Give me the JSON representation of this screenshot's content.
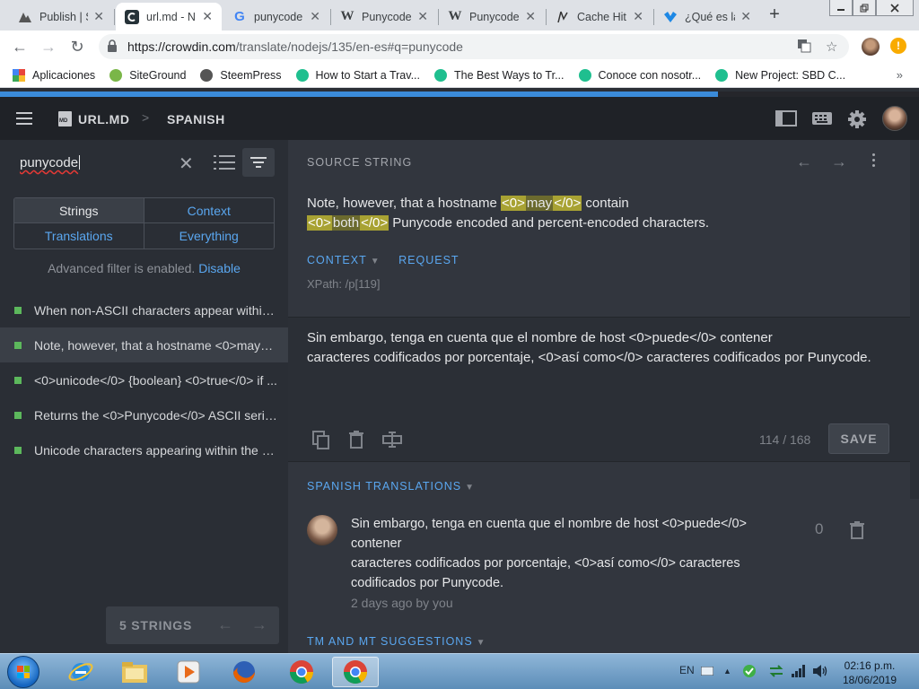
{
  "browser": {
    "tabs": [
      {
        "title": "Publish | S",
        "icon": "steempress-icon"
      },
      {
        "title": "url.md - N",
        "icon": "crowdin-icon",
        "active": true
      },
      {
        "title": "punycode",
        "icon": "google-icon"
      },
      {
        "title": "Punycode",
        "icon": "wikipedia-icon"
      },
      {
        "title": "Punycode",
        "icon": "wikipedia-icon"
      },
      {
        "title": "Cache Hit",
        "icon": "cache-icon"
      },
      {
        "title": "¿Qué es la",
        "icon": "checkmark-icon"
      }
    ],
    "new_tab_symbol": "+",
    "url_host": "https://crowdin.com",
    "url_path": "/translate/nodejs/135/en-es#q=punycode",
    "bookmarks": [
      {
        "label": "Aplicaciones",
        "icon": "apps-grid-icon",
        "color": "#e8453c"
      },
      {
        "label": "SiteGround",
        "icon": "siteground-icon",
        "color": "#7ab648"
      },
      {
        "label": "SteemPress",
        "icon": "wordpress-icon",
        "color": "#555555"
      },
      {
        "label": "How to Start a Trav...",
        "icon": "steemit-icon",
        "color": "#1fbf8f"
      },
      {
        "label": "The Best Ways to Tr...",
        "icon": "steemit-icon",
        "color": "#1fbf8f"
      },
      {
        "label": "Conoce con nosotr...",
        "icon": "steemit-icon",
        "color": "#1fbf8f"
      },
      {
        "label": "New Project: SBD C...",
        "icon": "steemit-icon",
        "color": "#1fbf8f"
      }
    ],
    "bookmarks_more": "»",
    "alert_symbol": "!"
  },
  "app": {
    "file_name": "URL.MD",
    "language": "SPANISH",
    "accent": "#5aa7f0",
    "approved_color": "#5cb85c"
  },
  "left": {
    "search_value": "punycode",
    "filters": [
      "Strings",
      "Context",
      "Translations",
      "Everything"
    ],
    "selected_filter": "Strings",
    "advanced_text": "Advanced filter is enabled.",
    "advanced_link": "Disable",
    "strings": [
      "When non-ASCII characters appear within ...",
      "Note, however, that a hostname <0>may</...",
      "<0>unicode</0> {boolean} <0>true</0> if ...",
      "Returns the <0>Punycode</0> ASCII serial...",
      "Unicode characters appearing within the h..."
    ],
    "selected_index": 1,
    "count_label": "5 STRINGS"
  },
  "source": {
    "heading": "SOURCE STRING",
    "p1": "Note, however, that a hostname ",
    "t1": "<0>",
    "w1": "may",
    "t2": "</0>",
    "p2": " contain",
    "t3": "<0>",
    "w2": "both",
    "t4": "</0>",
    "p3": " Punycode encoded and percent-encoded characters.",
    "context_label": "CONTEXT",
    "request_label": "REQUEST",
    "xpath": "XPath: /p[119]"
  },
  "translation": {
    "line1": "Sin embargo, tenga en cuenta que el nombre de host <0>puede</0> contener",
    "line2": "caracteres codificados por porcentaje, <0>así como</0> caracteres codificados por Punycode.",
    "char_count": "114 / 168",
    "save_label": "SAVE"
  },
  "suggestions": {
    "heading": "SPANISH TRANSLATIONS",
    "lines": [
      "Sin embargo, tenga en cuenta que el nombre de host <0>puede</0>",
      "contener",
      "caracteres codificados por porcentaje, <0>así como</0> caracteres",
      "codificados por Punycode."
    ],
    "meta": "2 days ago by you",
    "votes": "0",
    "tm_heading": "TM AND MT SUGGESTIONS"
  },
  "taskbar": {
    "language": "EN",
    "time": "02:16 p.m.",
    "date": "18/06/2019"
  }
}
